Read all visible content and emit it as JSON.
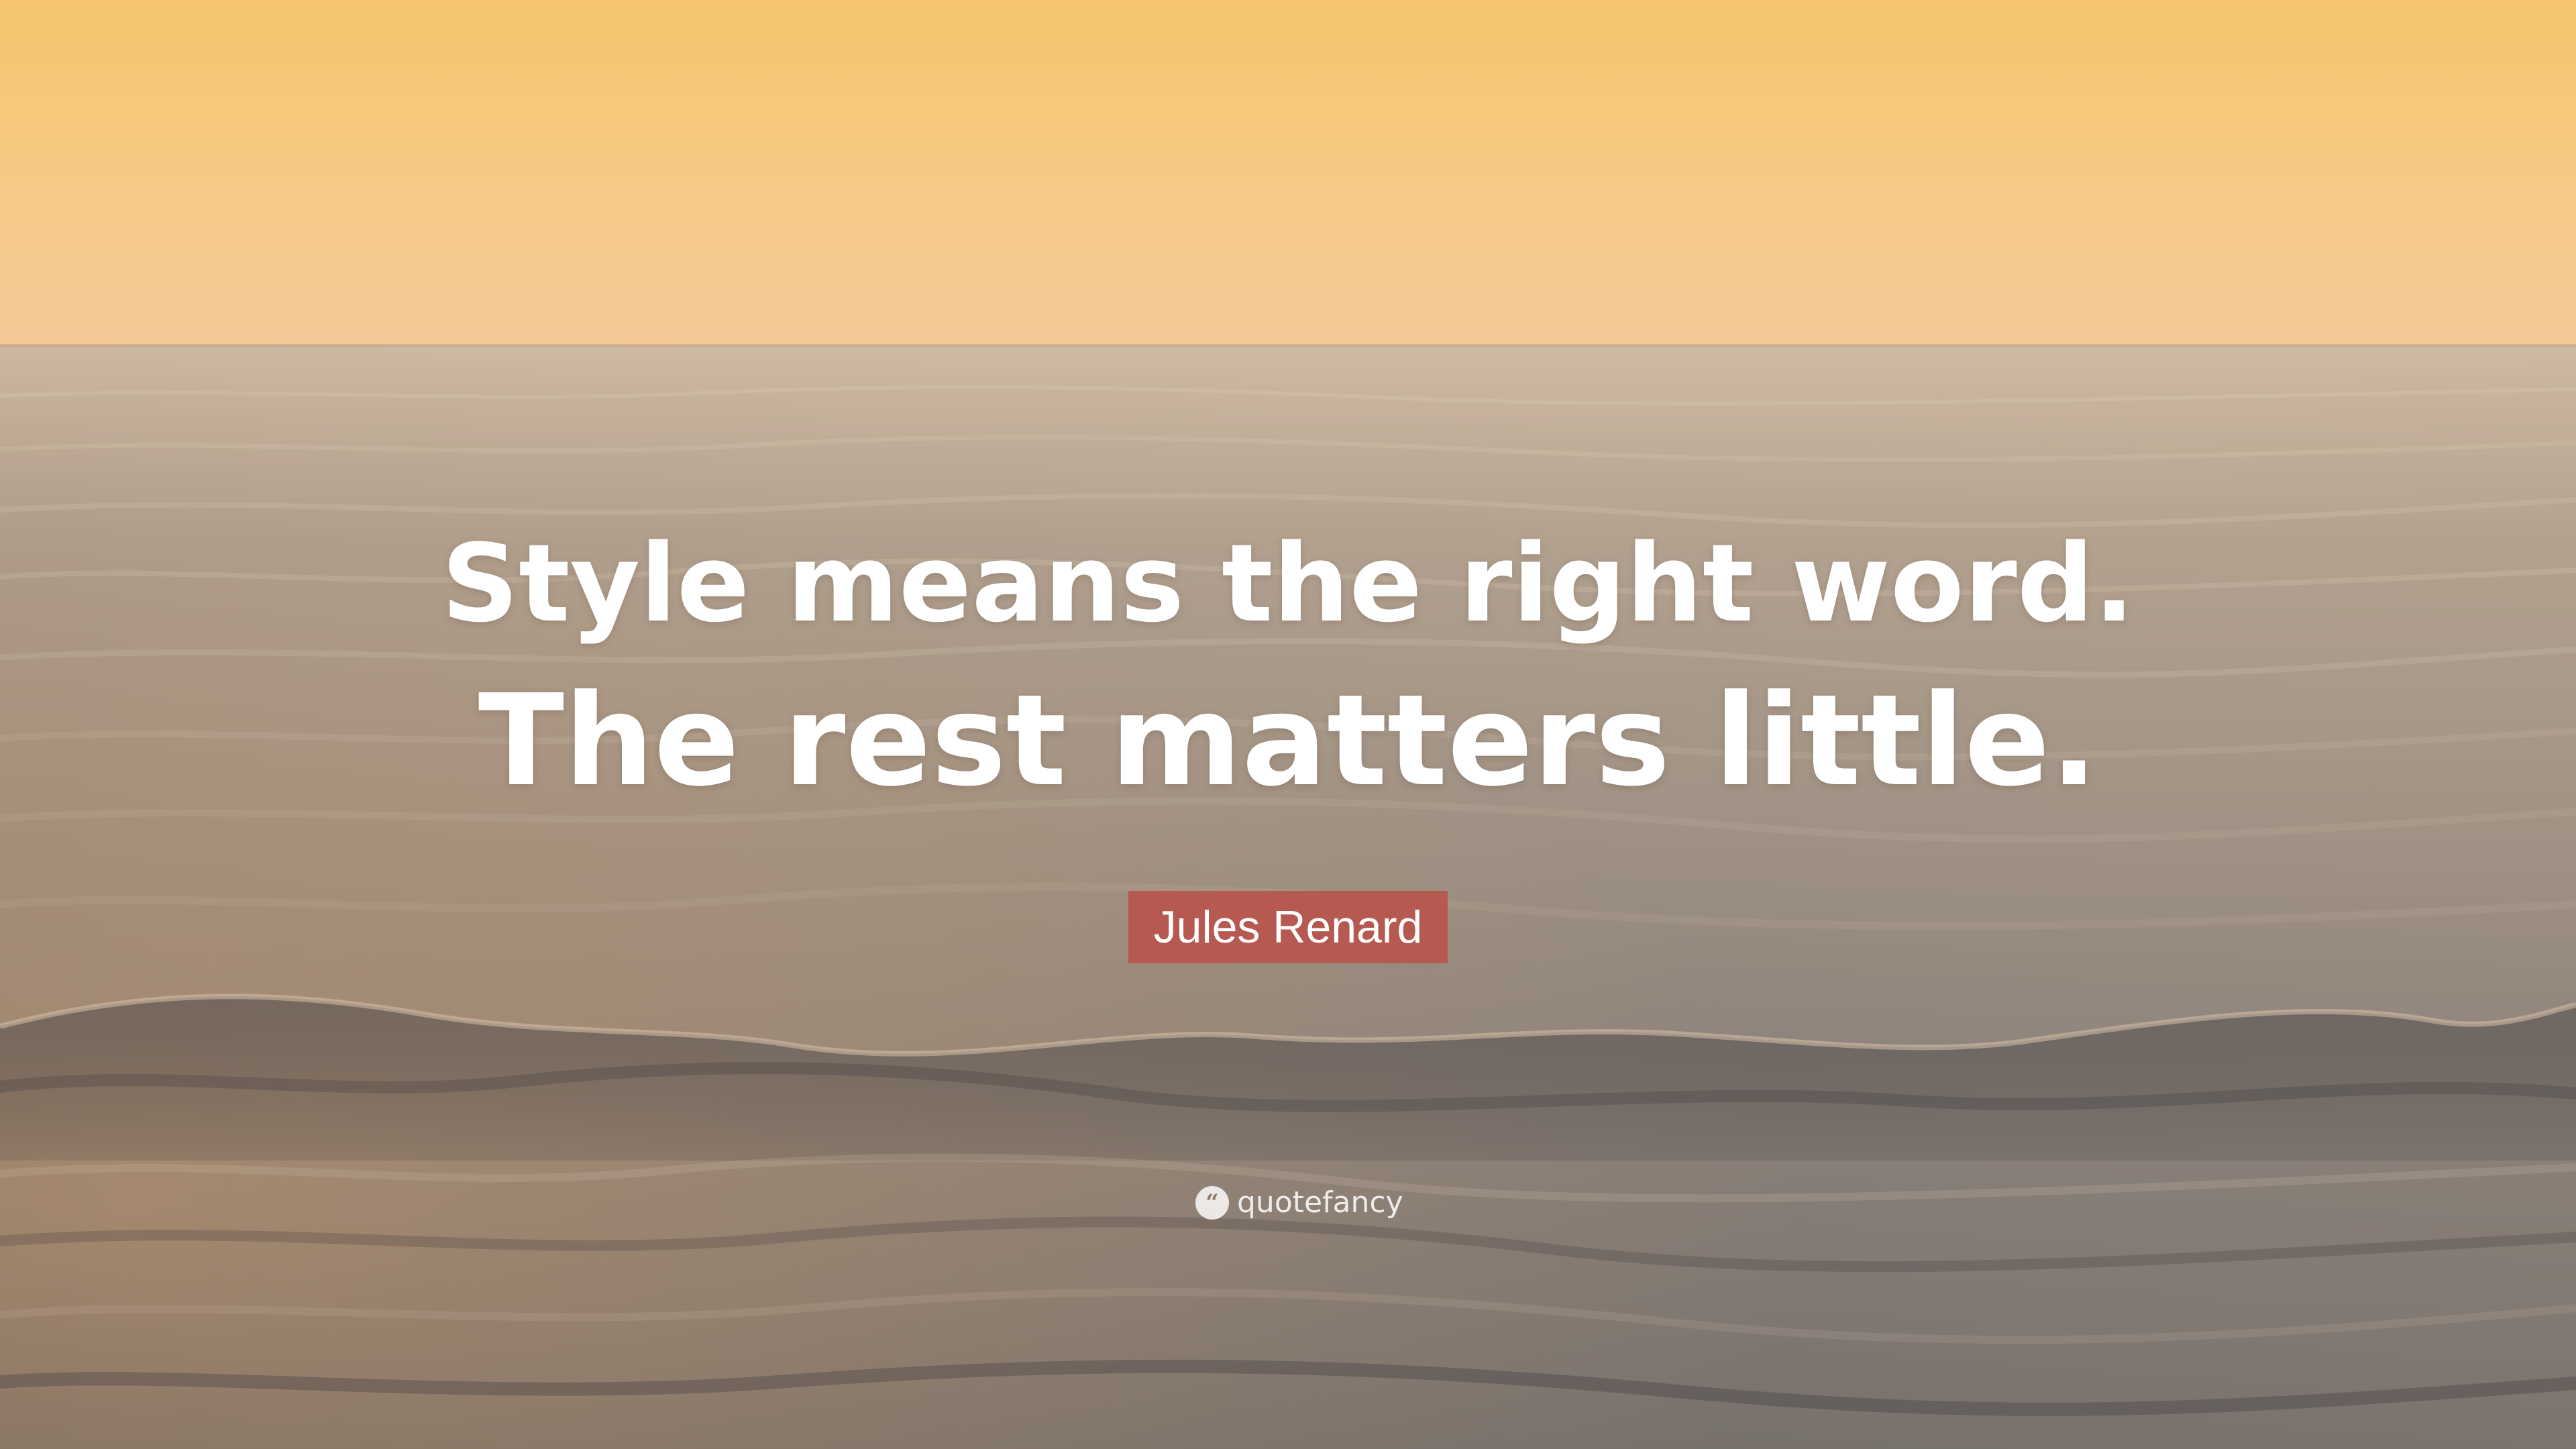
{
  "quote": {
    "line_1": "Style means the right word.",
    "line_2": "The rest matters little."
  },
  "author": {
    "name": "Jules Renard",
    "badge_color": "#b65a51"
  },
  "branding": {
    "text": "quotefancy",
    "icon": "quote-icon",
    "icon_glyph": "“"
  },
  "scene": {
    "sky_top_color": "#f5c676",
    "sky_horizon_color": "#f4cb95",
    "sea_color": "#8f8172",
    "wave_color": "#5f5853"
  }
}
